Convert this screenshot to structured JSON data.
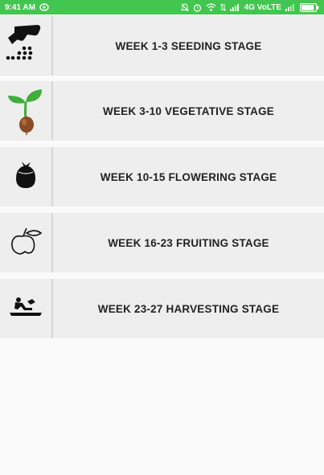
{
  "status_bar": {
    "time": "9:41 AM",
    "network": "4G VoLTE"
  },
  "stages": [
    {
      "label": "WEEK 1-3 SEEDING STAGE",
      "icon": "seeding-icon"
    },
    {
      "label": "WEEK 3-10 VEGETATIVE STAGE",
      "icon": "sprout-icon"
    },
    {
      "label": "WEEK 10-15 FLOWERING STAGE",
      "icon": "flower-bud-icon"
    },
    {
      "label": "WEEK 16-23 FRUITING STAGE",
      "icon": "fruit-icon"
    },
    {
      "label": "WEEK 23-27 HARVESTING STAGE",
      "icon": "harvest-icon"
    }
  ],
  "colors": {
    "status_bar": "#43c64f",
    "row_background": "#eeeeee",
    "page_background": "#fafafa",
    "sprout_leaf": "#3fae3a",
    "seed_brown": "#8a4b26"
  }
}
